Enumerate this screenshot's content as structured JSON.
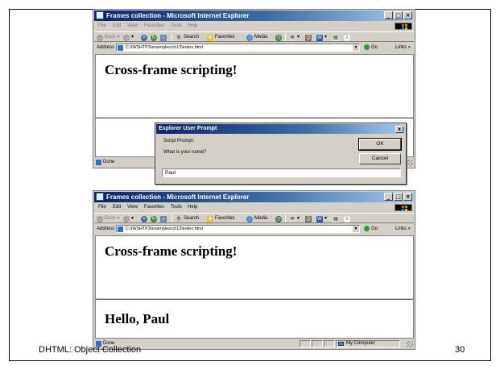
{
  "windows": [
    {
      "title": "Frames collection - Microsoft Internet Explorer",
      "menu": [
        "File",
        "Edit",
        "View",
        "Favorites",
        "Tools",
        "Help"
      ],
      "menu_disabled": true,
      "toolbar": {
        "back": "Back",
        "search": "Search",
        "favorites": "Favorites",
        "media": "Media"
      },
      "address_label": "Address",
      "address": "C:\\IW3HTP3\\examples\\ch13\\index.html",
      "go": "Go",
      "links": "Links",
      "heading": "Cross-frame scripting!",
      "frame_text": "",
      "status": "Done",
      "zone": ""
    },
    {
      "title": "Frames collection - Microsoft Internet Explorer",
      "menu": [
        "File",
        "Edit",
        "View",
        "Favorites",
        "Tools",
        "Help"
      ],
      "menu_disabled": false,
      "toolbar": {
        "back": "Back",
        "search": "Search",
        "favorites": "Favorites",
        "media": "Media"
      },
      "address_label": "Address",
      "address": "C:\\IW3HTP3\\examples\\ch13\\index.html",
      "go": "Go",
      "links": "Links",
      "heading": "Cross-frame scripting!",
      "frame_text": "Hello, Paul",
      "status": "Done",
      "zone": "My Computer"
    }
  ],
  "dialog": {
    "title": "Explorer User Prompt",
    "close": "x",
    "script_prompt": "Script Prompt:",
    "question": "What is your name?",
    "ok": "OK",
    "cancel": "Cancel",
    "value": "Paul"
  },
  "footer": {
    "text": "DHTML: Object Collection",
    "page": "30"
  },
  "colors": {
    "titlebar_start": "#0a246a",
    "titlebar_end": "#a6caf0",
    "chrome": "#d4d0c8"
  }
}
